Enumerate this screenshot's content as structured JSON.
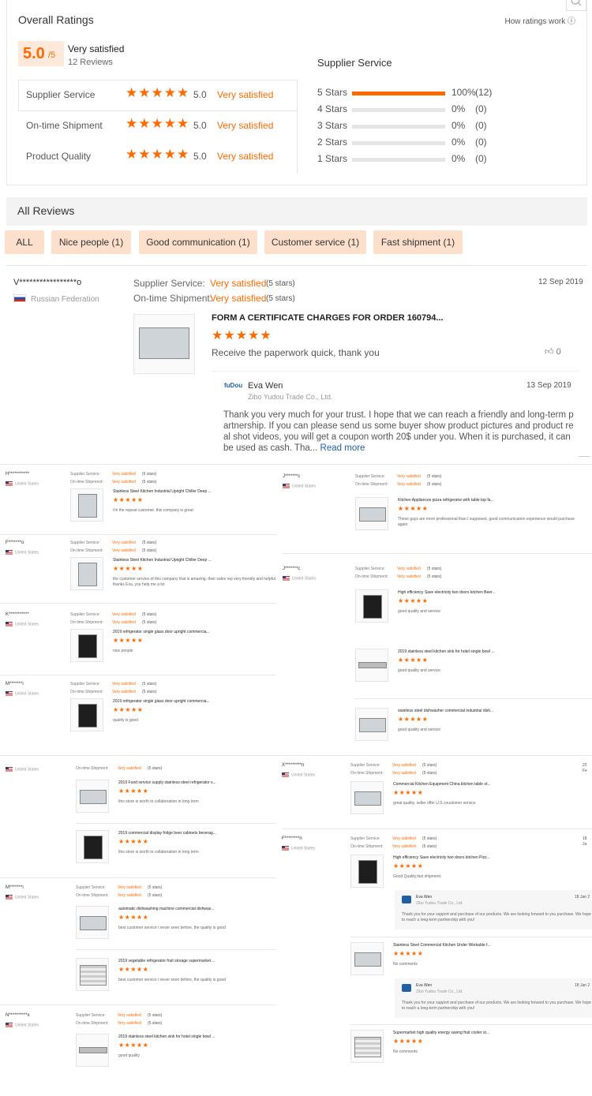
{
  "overall": {
    "title": "Overall Ratings",
    "how_link": "How ratings work",
    "score": "5.0",
    "score_suffix": "/5",
    "summary": "Very satisfied",
    "reviews": "12 Reviews",
    "categories": [
      {
        "label": "Supplier Service",
        "value": "5.0",
        "text": "Very satisfied"
      },
      {
        "label": "On-time Shipment",
        "value": "5.0",
        "text": "Very satisfied"
      },
      {
        "label": "Product Quality",
        "value": "5.0",
        "text": "Very satisfied"
      }
    ],
    "breakdown_title": "Supplier Service",
    "breakdown": [
      {
        "label": "5 Stars",
        "fraction": 1.0,
        "pct": "100%",
        "count": "(12)"
      },
      {
        "label": "4 Stars",
        "fraction": 0,
        "pct": "0%",
        "count": "(0)"
      },
      {
        "label": "3 Stars",
        "fraction": 0,
        "pct": "0%",
        "count": "(0)"
      },
      {
        "label": "2 Stars",
        "fraction": 0,
        "pct": "0%",
        "count": "(0)"
      },
      {
        "label": "1 Stars",
        "fraction": 0,
        "pct": "0%",
        "count": "(0)"
      }
    ]
  },
  "all_reviews": {
    "title": "All Reviews",
    "tags": [
      "ALL",
      "Nice people (1)",
      "Good communication (1)",
      "Customer service (1)",
      "Fast shipment (1)"
    ]
  },
  "featured": {
    "name": "V*****************o",
    "country": "Russian Federation",
    "ss_label": "Supplier Service:",
    "ss_text": "Very satisfied",
    "ss_stars": "(5 stars)",
    "os_label": "On-time Shipment:",
    "os_text": "Very satisfied",
    "os_stars": "(5 stars)",
    "date": "12 Sep 2019",
    "product": "FORM A CERTIFICATE CHARGES FOR ORDER 160794...",
    "review": "Receive the paperwork quick, thank you",
    "likes": "0",
    "reply_name": "Eva Wen",
    "reply_company": "Zibo Yudou Trade Co., Ltd.",
    "reply_date": "13 Sep 2019",
    "reply_text": "Thank you very much for your trust. I hope that we can reach a friendly and long-term partnership. If you can please send us some buyer show product pictures and product real shot videos, you will get a coupon worth 20$ under you. When it is purchased, it can be used as cash. Tha...",
    "read_more": "Read more",
    "logo_text": "fuDou"
  },
  "labels": {
    "ss": "Supplier Service:",
    "os": "On-time Shipment:",
    "vs": "Very satisfied",
    "five": "(5 stars)",
    "us": "United States",
    "stars": "★★★★★",
    "eva": "Eva Wen",
    "company": "Zibo Yudou Trade Co., Ltd.",
    "reply_date": "18 Jan 2",
    "reply_text": "Thank you for your support and purchase of our products. We are looking forward to you purchase. We hope to reach a long-term partnership with you!",
    "date_22": "22 Fe",
    "date_18": "18 Ja"
  },
  "left_reviews": [
    {
      "name": "H***********",
      "product": "Stainless Steel Kitchen Industrial Upright Chiller Deep ...",
      "text": "i'm the repeat customer, this company is great"
    },
    {
      "name": "F*******o",
      "product": "Stainless Steel Kitchen Industrial Upright Chiller Deep ...",
      "text": "the customer service of this company that is amazing, their sales rep very friendly and helpful. thanks Eva, you help me a lot"
    },
    {
      "name": "K***********",
      "product": "2019 refrigerator single glass door upright commercia...",
      "text": "nice people"
    },
    {
      "name": "M*******i",
      "product": "2019 refrigerator single glass door upright commercia...",
      "text": "quality is good"
    }
  ],
  "right_reviews": [
    {
      "name": "J*******c",
      "product": "Kitchen Appliances pizza refrigerator with table top fa...",
      "text": "These guys are more professional than I supposed. good communication experience would purchase again."
    },
    {
      "name": "J*******c",
      "product": "High efficiency Save electricity two doors kitchen Beer...",
      "text": "good quality and service"
    }
  ],
  "right_extra": [
    {
      "product": "2019 stainless steel kitchen sink for hotel single bowl ...",
      "text": "good quality and service"
    },
    {
      "product": "stainless steel dishwasher commercial industrial dish...",
      "text": "good quality and service"
    }
  ],
  "bottom_left": [
    {
      "product": "2019 Food service supply stainless steel refrigerator s...",
      "text": "this store is worth to collaboration in long term"
    },
    {
      "product": "2019 commercial display fridge beer cabinets beverag...",
      "text": "this store is worth to collaboration in long term"
    }
  ],
  "bottom_left2": {
    "name": "M*******i",
    "items": [
      {
        "product": "automatic dishwashing machine commercial dishwas...",
        "text": "best customer service i never seen before, the quality is good"
      },
      {
        "product": "2019 vegetable refrigerator fruit storage supermarket ...",
        "text": "best customer service i never seen before, the quality is good"
      }
    ]
  },
  "bottom_left3": {
    "name": "N**********x",
    "product": "2019 stainless steel kitchen sink for hotel single bowl ...",
    "text": "good quality"
  },
  "bottom_right": [
    {
      "name": "X*********n",
      "product": "Commercial Kitchen Equipment China kitchen table st...",
      "text": "great quality. seller offer U.S coustomer service"
    },
    {
      "name": "F********n",
      "product": "High efficiency Save electricity two doors kitchen Pizz...",
      "text": "Good Quality.fast shipment."
    }
  ],
  "bottom_right_extra": [
    {
      "product": "Stainless Steel Commercial Kitchen Under Workable f...",
      "text": "No comments"
    },
    {
      "product": "Supermarket high quality energy saving fruit cooler st...",
      "text": "No comments"
    }
  ]
}
